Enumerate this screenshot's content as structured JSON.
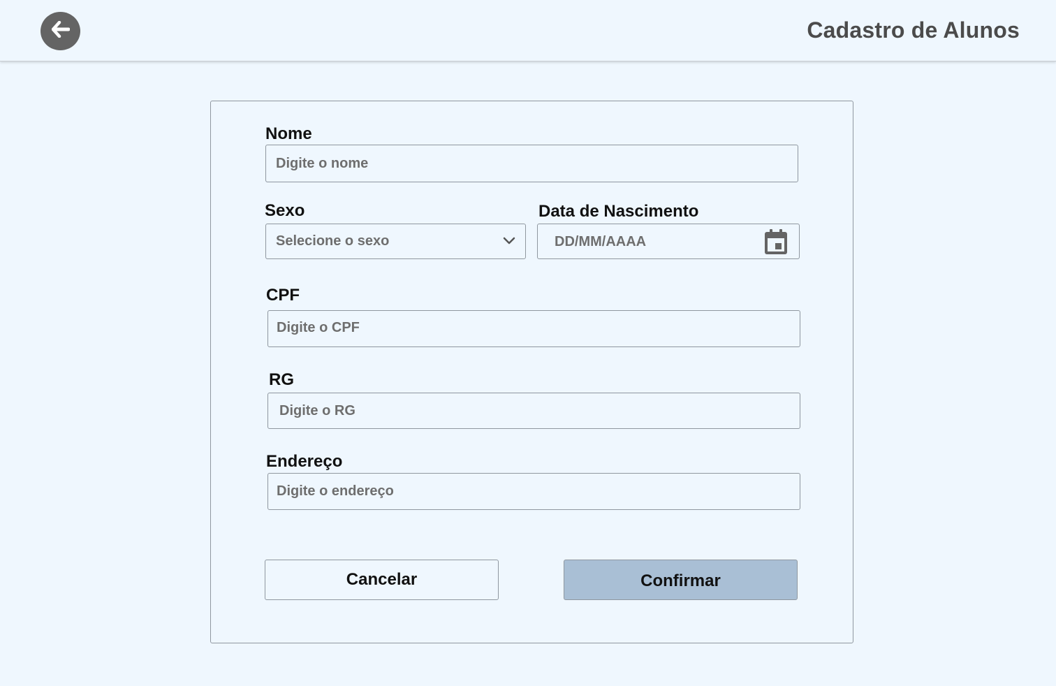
{
  "header": {
    "title": "Cadastro de Alunos",
    "back_icon": "arrow-left-icon"
  },
  "form": {
    "nome": {
      "label": "Nome",
      "placeholder": "Digite o nome"
    },
    "sexo": {
      "label": "Sexo",
      "placeholder": "Selecione o sexo",
      "icon": "chevron-down-icon"
    },
    "data_nascimento": {
      "label": "Data de Nascimento",
      "placeholder": "DD/MM/AAAA",
      "icon": "calendar-icon"
    },
    "cpf": {
      "label": "CPF",
      "placeholder": "Digite o CPF"
    },
    "rg": {
      "label": "RG",
      "placeholder": "Digite o RG"
    },
    "endereco": {
      "label": "Endereço",
      "placeholder": "Digite o endereço"
    }
  },
  "actions": {
    "cancel_label": "Cancelar",
    "confirm_label": "Confirmar",
    "confirm_color": "#a9bfd5"
  },
  "colors": {
    "background": "#eff7fe",
    "back_button": "#646464",
    "title": "#4b4b4b"
  }
}
